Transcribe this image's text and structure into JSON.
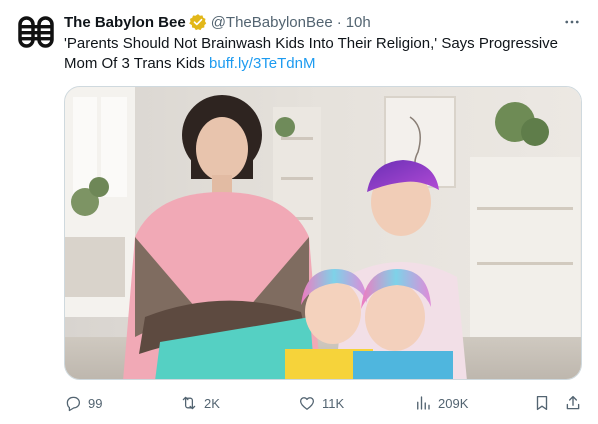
{
  "tweet": {
    "display_name": "The Babylon Bee",
    "handle": "@TheBabylonBee",
    "separator": "·",
    "time": "10h",
    "text": "'Parents Should Not Brainwash Kids Into Their Religion,' Says Progressive Mom Of 3 Trans Kids",
    "link": "buff.ly/3TeTdnM",
    "avatar_icon": "babylon-bee-logo-icon",
    "verified_icon": "verified-badge-icon",
    "more_icon": "more-options-icon"
  },
  "actions": {
    "reply": {
      "icon": "reply-icon",
      "count": "99"
    },
    "retweet": {
      "icon": "retweet-icon",
      "count": "2K"
    },
    "like": {
      "icon": "heart-icon",
      "count": "11K"
    },
    "views": {
      "icon": "views-icon",
      "count": "209K"
    },
    "bookmark": {
      "icon": "bookmark-icon"
    },
    "share": {
      "icon": "share-icon"
    }
  },
  "colors": {
    "text": "#0f1419",
    "secondary": "#536471",
    "link": "#1d9bf0",
    "verified_gold": "#e2b719",
    "logo_black": "#111111"
  }
}
